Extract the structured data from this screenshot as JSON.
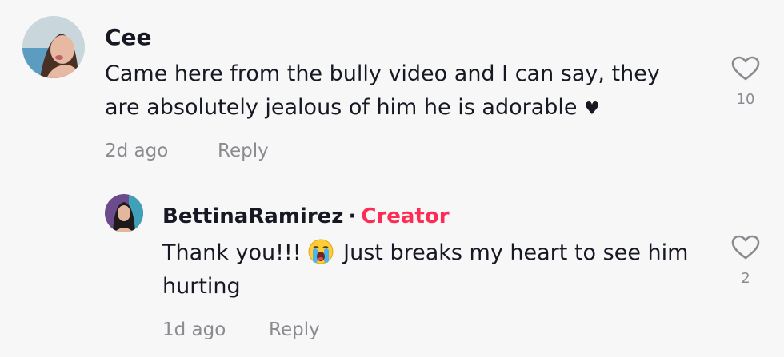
{
  "comments": [
    {
      "username": "Cee",
      "text_line1": "Came here from the bully video and I can say, they",
      "text_line2": "are absolutely jealous of him he is adorable",
      "text_trailing_icon": "heart-suit-icon",
      "time": "2d ago",
      "reply_label": "Reply",
      "like_count": "10",
      "like_icon": "heart-outline-icon"
    }
  ],
  "replies": [
    {
      "username": "BettinaRamirez",
      "separator": "·",
      "badge": "Creator",
      "text_prefix": "Thank you!!!",
      "text_emoji": "loudly-crying-face-icon",
      "text_suffix": "Just breaks my heart to see him",
      "text_line2": "hurting",
      "time": "1d ago",
      "reply_label": "Reply",
      "like_count": "2",
      "like_icon": "heart-outline-icon"
    }
  ],
  "colors": {
    "background": "#f7f7f7",
    "text": "#161823",
    "muted": "#8a8b91",
    "creator_accent": "#fe2c55"
  }
}
